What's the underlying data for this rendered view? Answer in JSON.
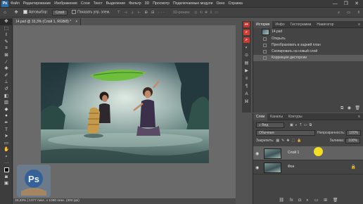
{
  "menu": {
    "logo": "Ps",
    "items": [
      "Файл",
      "Редактирование",
      "Изображение",
      "Слои",
      "Текст",
      "Выделение",
      "Фильтр",
      "3D",
      "Просмотр",
      "Подключаемые модули",
      "Окно",
      "Справка"
    ]
  },
  "window_controls": {
    "minimize": "—",
    "maximize": "❐",
    "close": "✕"
  },
  "options": {
    "autoselect_label": "Автовыбор:",
    "autoselect_value": "Слой",
    "show_controls_label": "Показать упр. элем.",
    "mode_3d": "3D-режим:"
  },
  "document": {
    "tab_title": "14.psd @ 33,3% (Слой 1, RGB/8) *",
    "close": "×",
    "status": "33,33%  |  1377 пикс. x 1080 пикс. (300 ppi)"
  },
  "history": {
    "tabs": [
      "История",
      "Инфо",
      "Гистограмма",
      "Навигатор"
    ],
    "snapshot": "14.psd",
    "items": [
      "Открыть",
      "Преобразовать в задний план",
      "Скопировать на новый слой",
      "Коррекция дисторсии"
    ],
    "selected_index": 3
  },
  "layers": {
    "tabs": [
      "Слои",
      "Каналы",
      "Контуры"
    ],
    "filter": "Вид",
    "blend_mode": "Обычные",
    "opacity_label": "Непрозрачность:",
    "opacity_value": "100%",
    "lock_label": "Закрепить:",
    "fill_label": "Заливка:",
    "fill_value": "100%",
    "list": [
      {
        "name": "Слой 1",
        "active": true
      },
      {
        "name": "Фон",
        "active": false
      }
    ]
  },
  "iconstrip": {
    "badges": [
      {
        "text": "FP",
        "color": "#c8322d"
      },
      {
        "text": "F",
        "color": "#d04030"
      },
      {
        "text": "P",
        "color": "#c93a33"
      }
    ]
  },
  "watermark": {
    "text": "Ps"
  }
}
